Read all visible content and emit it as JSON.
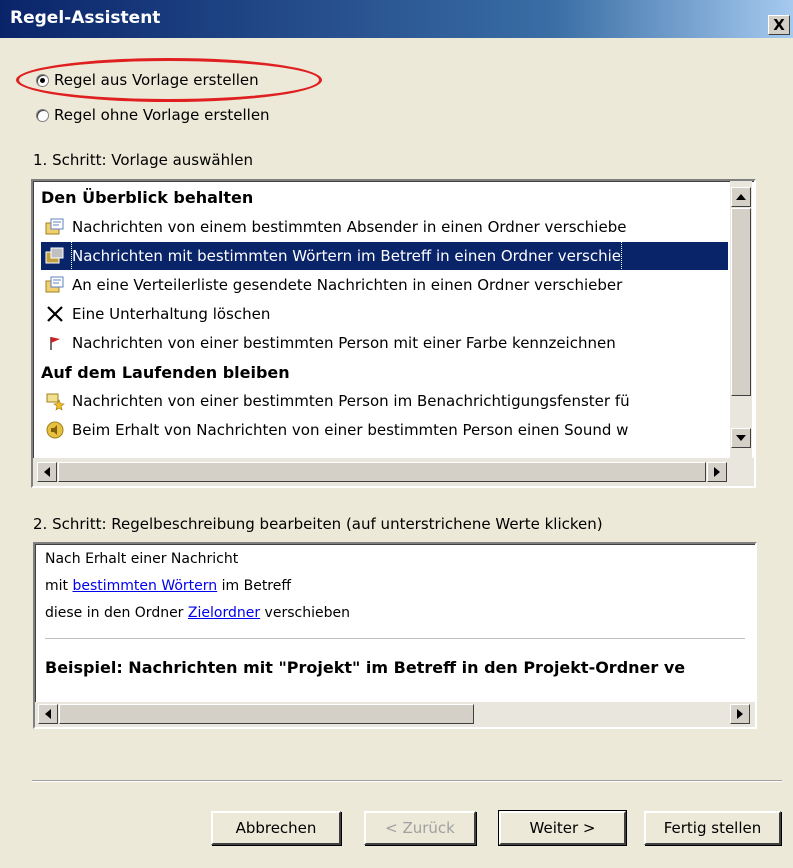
{
  "window": {
    "title": "Regel-Assistent",
    "close_glyph": "X"
  },
  "mode": {
    "options": [
      {
        "label": "Regel aus Vorlage erstellen",
        "checked": true
      },
      {
        "label": "Regel ohne Vorlage erstellen",
        "checked": false
      }
    ]
  },
  "step1": {
    "label": "1. Schritt: Vorlage auswählen",
    "groups": [
      {
        "heading": "Den Überblick behalten",
        "items": [
          {
            "icon": "move-to-folder-icon",
            "text": "Nachrichten von einem bestimmten Absender in einen Ordner verschiebe"
          },
          {
            "icon": "move-to-folder-icon",
            "text": "Nachrichten mit bestimmten Wörtern im Betreff in einen Ordner verschie",
            "selected": true
          },
          {
            "icon": "move-to-folder-icon",
            "text": "An eine Verteilerliste gesendete Nachrichten in einen Ordner verschieber"
          },
          {
            "icon": "delete-x-icon",
            "text": "Eine Unterhaltung löschen"
          },
          {
            "icon": "red-flag-icon",
            "text": "Nachrichten von einer bestimmten Person mit einer Farbe kennzeichnen"
          }
        ]
      },
      {
        "heading": "Auf dem Laufenden bleiben",
        "items": [
          {
            "icon": "alert-envelope-icon",
            "text": "Nachrichten von einer bestimmten Person im Benachrichtigungsfenster fü"
          },
          {
            "icon": "sound-speaker-icon",
            "text": "Beim Erhalt von Nachrichten von einer bestimmten Person einen Sound w"
          }
        ]
      }
    ]
  },
  "step2": {
    "label": "2. Schritt: Regelbeschreibung bearbeiten (auf unterstrichene Werte klicken)",
    "line1": "Nach Erhalt einer Nachricht",
    "line2_prefix": "mit ",
    "line2_link": "bestimmten Wörtern",
    "line2_suffix": " im Betreff",
    "line3_prefix": "diese in den Ordner ",
    "line3_link": "Zielordner",
    "line3_suffix": " verschieben",
    "example": "Beispiel: Nachrichten mit \"Projekt\" im Betreff in den Projekt-Ordner ve"
  },
  "buttons": {
    "cancel": "Abbrechen",
    "back": "< Zurück",
    "next": "Weiter >",
    "finish": "Fertig stellen"
  },
  "colors": {
    "highlight_oval": "#e02020",
    "selection": "#0a246a",
    "link": "#0000ee"
  }
}
